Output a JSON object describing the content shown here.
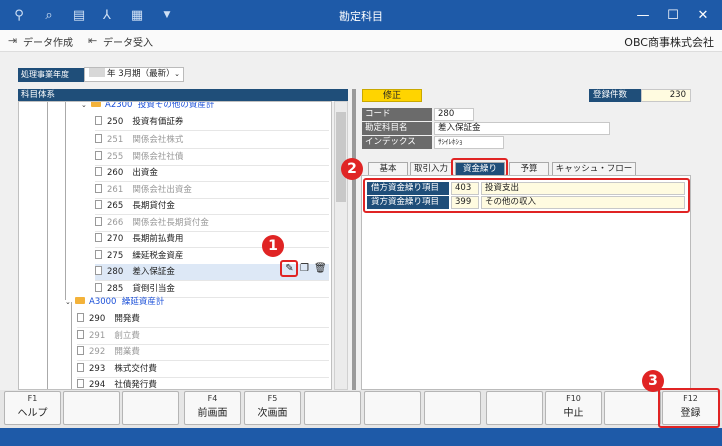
{
  "window": {
    "title": "勘定科目"
  },
  "toolbar": {
    "create": "データ作成",
    "import": "データ受入",
    "company": "OBC商事株式会社"
  },
  "fiscal": {
    "label": "処理事業年度",
    "value": "年  3月期（最新）"
  },
  "tree": {
    "header": "科目体系",
    "group1": {
      "code": "A2300",
      "name": "投資その他の資産計"
    },
    "rows1": [
      {
        "code": "250",
        "name": "投資有価証券"
      },
      {
        "code": "251",
        "name": "関係会社株式"
      },
      {
        "code": "255",
        "name": "関係会社社債"
      },
      {
        "code": "260",
        "name": "出資金"
      },
      {
        "code": "261",
        "name": "関係会社出資金"
      },
      {
        "code": "265",
        "name": "長期貸付金"
      },
      {
        "code": "266",
        "name": "関係会社長期貸付金"
      },
      {
        "code": "270",
        "name": "長期前払費用"
      },
      {
        "code": "275",
        "name": "繰延税金資産"
      },
      {
        "code": "280",
        "name": "差入保証金"
      },
      {
        "code": "285",
        "name": "貸倒引当金"
      }
    ],
    "group2": {
      "code": "A3000",
      "name": "繰延資産計"
    },
    "rows2": [
      {
        "code": "290",
        "name": "開発費"
      },
      {
        "code": "291",
        "name": "創立費"
      },
      {
        "code": "292",
        "name": "開業費"
      },
      {
        "code": "293",
        "name": "株式交付費"
      },
      {
        "code": "294",
        "name": "社債発行費"
      }
    ]
  },
  "badges": {
    "b1": "1",
    "b2": "2",
    "b3": "3"
  },
  "detail": {
    "mode": "修正",
    "count_label": "登録件数",
    "count_value": "230",
    "code_label": "コード",
    "code_value": "280",
    "name_label": "勘定科目名",
    "name_value": "差入保証金",
    "index_label": "インデックス",
    "index_value": "ｻｼｲﾚﾎｼｮ",
    "tabs": [
      "基本",
      "取引入力",
      "資金繰り",
      "予算",
      "キャッシュ・フロー"
    ],
    "cash": [
      {
        "label": "借方資金繰り項目",
        "code": "403",
        "name": "投資支出"
      },
      {
        "label": "貸方資金繰り項目",
        "code": "399",
        "name": "その他の収入"
      }
    ]
  },
  "fkeys": [
    {
      "key": "F1",
      "label": "ヘルプ"
    },
    {
      "key": "",
      "label": ""
    },
    {
      "key": "",
      "label": ""
    },
    {
      "key": "F4",
      "label": "前画面"
    },
    {
      "key": "F5",
      "label": "次画面"
    },
    {
      "key": "",
      "label": ""
    },
    {
      "key": "",
      "label": ""
    },
    {
      "key": "",
      "label": ""
    },
    {
      "key": "",
      "label": ""
    },
    {
      "key": "F10",
      "label": "中止"
    },
    {
      "key": "",
      "label": ""
    },
    {
      "key": "F12",
      "label": "登録"
    }
  ],
  "colors": {
    "title_bar": "#1e5aa8",
    "navy": "#1f4e79",
    "yellow": "#ffd400",
    "callout_red": "#e02424"
  }
}
